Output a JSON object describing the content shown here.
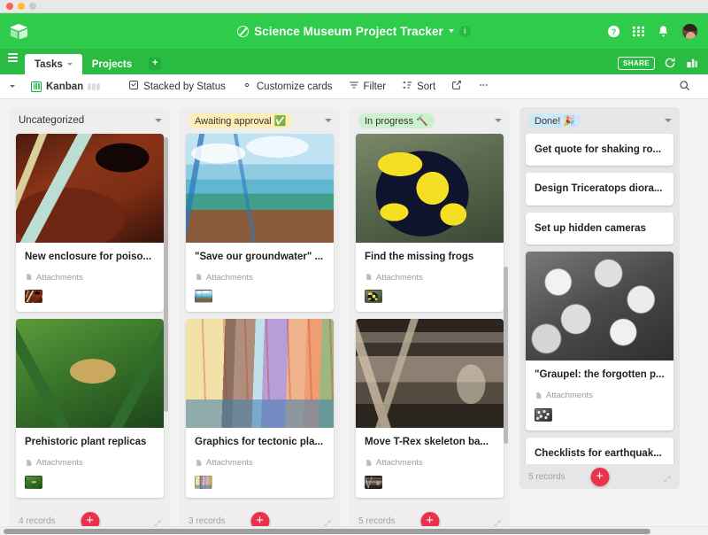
{
  "window": {
    "traffic_lights": [
      "close",
      "minimize",
      "zoom"
    ]
  },
  "header": {
    "logo": "airtable-logo",
    "base_title": "Science Museum Project Tracker",
    "base_menu_caret": "caret-down-icon",
    "info_badge": "i",
    "right_icons": [
      "help-icon",
      "apps-grid-icon",
      "notifications-bell-icon",
      "user-avatar"
    ]
  },
  "tabs": {
    "menu_icon": "hamburger-icon",
    "items": [
      {
        "label": "Tasks",
        "active": true
      },
      {
        "label": "Projects",
        "active": false
      }
    ],
    "add_table_icon": "add-table-icon",
    "share_label": "SHARE",
    "history_icon": "history-icon",
    "apps_icon": "blocks-icon"
  },
  "toolbar": {
    "view_caret": "caret-down-icon",
    "view_icon": "kanban-view-icon",
    "view_name": "Kanban",
    "collaborators_icon": "collaborators-icon",
    "stacked_by": "Stacked by Status",
    "stacked_by_icon": "stack-icon",
    "customize_cards": "Customize cards",
    "customize_icon": "gear-icon",
    "filter": "Filter",
    "filter_icon": "filter-icon",
    "sort": "Sort",
    "sort_icon": "sort-icon",
    "share_view_icon": "share-view-icon",
    "more_icon": "ellipsis-icon",
    "search_icon": "search-icon"
  },
  "board": {
    "attachments_label": "Attachments",
    "attachment_icon": "attachment-field-icon",
    "add_record_icon": "plus-icon",
    "expand_icon": "expand-stack-icon",
    "stacks": [
      {
        "id": "uncategorized",
        "title": "Uncategorized",
        "pill_style": "none",
        "record_count": "4 records",
        "cards": [
          {
            "title": "New enclosure for poiso...",
            "has_image": true,
            "image": "red-poison-dart-frog-photo",
            "image_class": "img-dartfrog-red",
            "attachments": true,
            "thumb_class": "img-dartfrog-red"
          },
          {
            "title": "Prehistoric plant replicas",
            "has_image": true,
            "image": "cycad-plant-photo",
            "image_class": "img-cycad",
            "attachments": true,
            "thumb_class": "img-cycad"
          }
        ]
      },
      {
        "id": "awaiting-approval",
        "title": "Awaiting approval ✅",
        "pill_style": "amber",
        "record_count": "3 records",
        "cards": [
          {
            "title": "\"Save our groundwater\" ...",
            "has_image": true,
            "image": "water-cycle-diagram",
            "image_class": "img-watercycle",
            "attachments": true,
            "thumb_class": "img-watercycle"
          },
          {
            "title": "Graphics for tectonic pla...",
            "has_image": true,
            "image": "tectonic-plates-map",
            "image_class": "img-tectonic",
            "attachments": true,
            "thumb_class": "img-tectonic"
          }
        ]
      },
      {
        "id": "in-progress",
        "title": "In progress 🔨",
        "pill_style": "greenlt",
        "record_count": "5 records",
        "cards": [
          {
            "title": "Find the missing frogs",
            "has_image": true,
            "image": "yellow-banded-poison-dart-frog-photo",
            "image_class": "img-dartfrog-yellow",
            "attachments": true,
            "thumb_class": "img-dartfrog-yellow"
          },
          {
            "title": "Move T-Rex skeleton ba...",
            "has_image": true,
            "image": "t-rex-skeleton-photo",
            "image_class": "img-trex",
            "attachments": true,
            "thumb_class": "img-trex"
          }
        ]
      },
      {
        "id": "done",
        "title": "Done! 🎉",
        "pill_style": "bluelt",
        "record_count": "5 records",
        "cards": [
          {
            "title": "Get quote for shaking ro...",
            "has_image": false,
            "attachments": false
          },
          {
            "title": "Design Triceratops diora...",
            "has_image": false,
            "attachments": false
          },
          {
            "title": "Set up hidden cameras",
            "has_image": false,
            "attachments": false
          },
          {
            "title": "\"Graupel: the forgotten p...",
            "has_image": true,
            "image": "graupel-microscope-photo",
            "image_class": "img-graupel",
            "attachments": true,
            "thumb_class": "img-graupel"
          },
          {
            "title": "Checklists for earthquak...",
            "has_image": false,
            "attachments": false
          }
        ]
      }
    ]
  },
  "colors": {
    "brand_green": "#2ecc4a",
    "header_green": "#29bb42",
    "board_bg": "#f4f4f4",
    "stack_bg": "#eeeeee",
    "add_record_red": "#e8334a",
    "pill_amber": "#fdeeb8",
    "pill_green": "#ccf0ce",
    "pill_blue": "#cfe8f7"
  }
}
